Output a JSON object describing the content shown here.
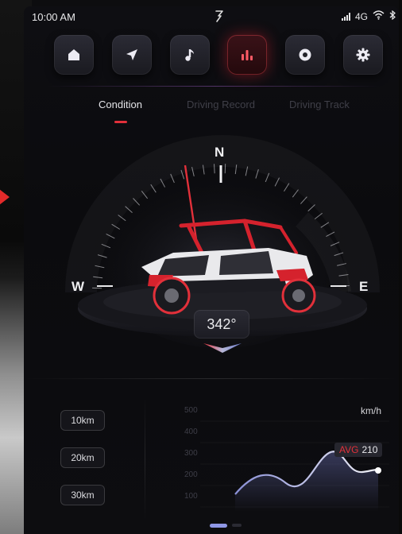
{
  "status_bar": {
    "time": "10:00 AM",
    "network": "4G",
    "icons": [
      "brand-logo-icon",
      "signal-icon",
      "wifi-icon",
      "bluetooth-icon"
    ]
  },
  "nav": {
    "items": [
      {
        "name": "home",
        "icon": "home-icon",
        "active": false
      },
      {
        "name": "navigation",
        "icon": "navigation-arrow-icon",
        "active": false
      },
      {
        "name": "music",
        "icon": "music-note-icon",
        "active": false
      },
      {
        "name": "statistics",
        "icon": "bar-chart-icon",
        "active": true
      },
      {
        "name": "camera",
        "icon": "camera-lens-icon",
        "active": false
      },
      {
        "name": "settings",
        "icon": "gear-icon",
        "active": false
      }
    ]
  },
  "tabs": [
    {
      "label": "Condition",
      "active": true
    },
    {
      "label": "Driving Record",
      "active": false
    },
    {
      "label": "Driving Track",
      "active": false
    }
  ],
  "compass": {
    "north": "N",
    "west": "W",
    "east": "E",
    "heading": "342°",
    "heading_degrees": 342
  },
  "distance_filters": [
    "10km",
    "20km",
    "30km"
  ],
  "speed_chart": {
    "unit": "km/h",
    "y_ticks": [
      "500",
      "400",
      "300",
      "200",
      "100"
    ],
    "avg_label": "AVG",
    "avg_value": "210"
  },
  "colors": {
    "accent_red": "#e2303a",
    "text_primary": "#e4e4e8",
    "text_dim": "#3f3f48",
    "background": "#0d0d0f"
  }
}
